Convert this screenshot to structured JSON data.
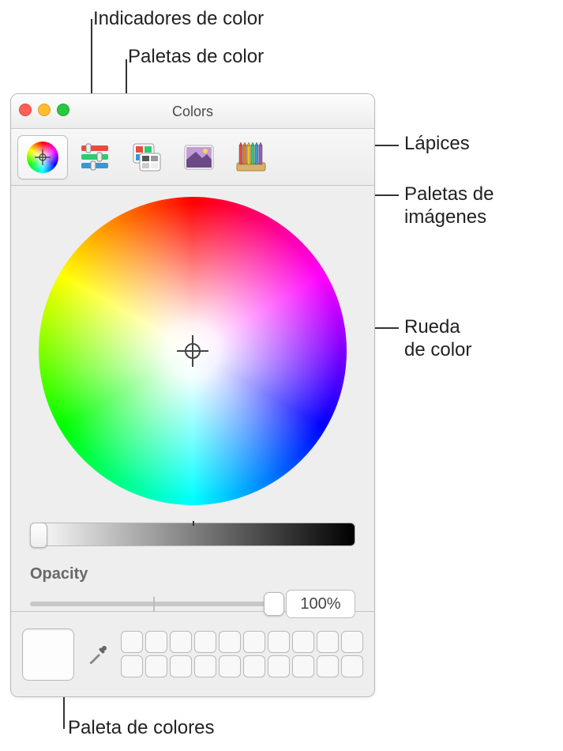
{
  "callouts": {
    "indicadores": "Indicadores de color",
    "paletas_color": "Paletas de color",
    "lapices": "Lápices",
    "paletas_img_1": "Paletas de",
    "paletas_img_2": "imágenes",
    "rueda_1": "Rueda",
    "rueda_2": "de color",
    "paleta_colores": "Paleta de colores"
  },
  "window": {
    "title": "Colors"
  },
  "controls": {
    "opacity_label": "Opacity",
    "opacity_value": "100%"
  }
}
